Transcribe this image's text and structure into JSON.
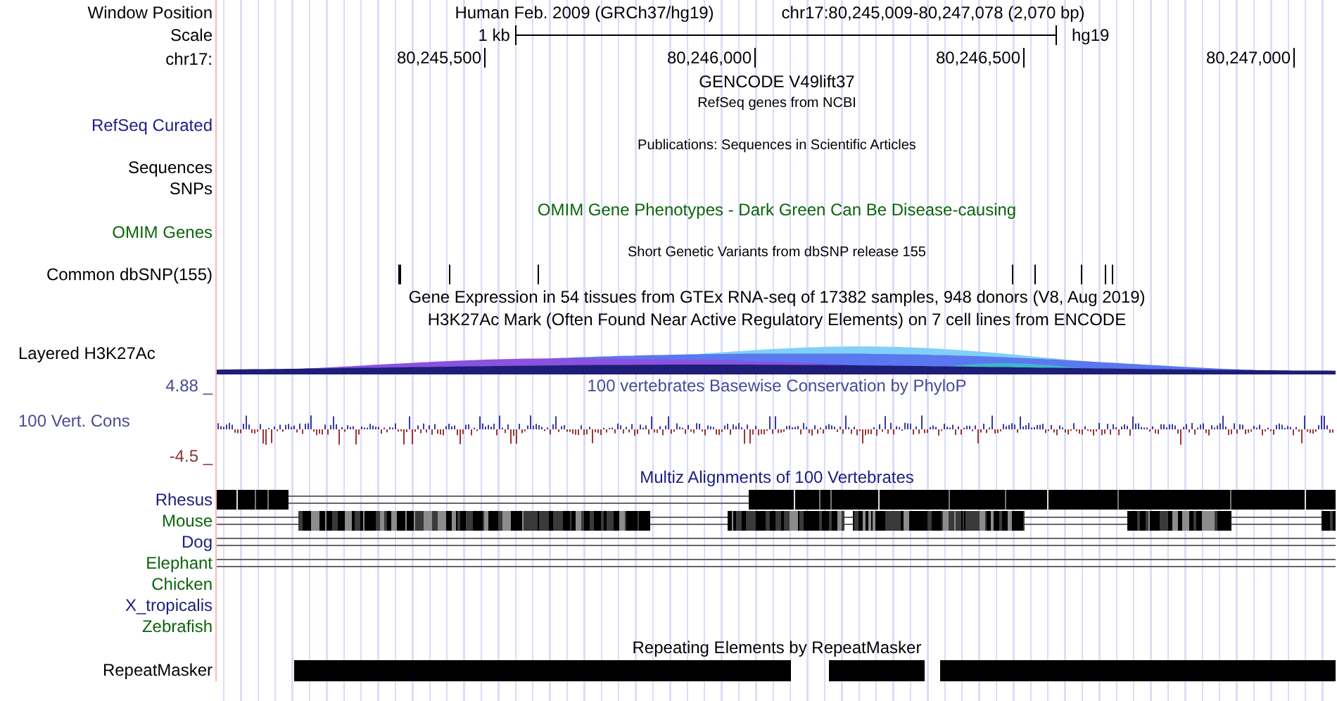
{
  "rows": [
    {
      "kind": "position",
      "label": "Window Position",
      "texts": [
        "Human Feb. 2009 (GRCh37/hg19)",
        "chr17:80,245,009-80,247,078 (2,070 bp)"
      ]
    },
    {
      "kind": "scale",
      "label": "Scale",
      "length": "1 kb",
      "assembly": "hg19"
    },
    {
      "kind": "ruler",
      "label": "chr17:",
      "ticks": [
        "80,245,500",
        "80,246,000",
        "80,246,500",
        "80,247,000"
      ]
    },
    {
      "kind": "title",
      "title": "GENCODE V49lift37"
    },
    {
      "kind": "subtitle",
      "title": "RefSeq genes from NCBI"
    },
    {
      "kind": "blank",
      "label": "RefSeq Curated",
      "color": "#1c1c8c"
    },
    {
      "kind": "subtitle",
      "title": "Publications: Sequences in Scientific Articles"
    },
    {
      "kind": "blank",
      "label": "Sequences"
    },
    {
      "kind": "blank",
      "label": "SNPs"
    },
    {
      "kind": "title",
      "title": "OMIM Gene Phenotypes - Dark Green Can Be Disease-causing",
      "color": "#0c640c"
    },
    {
      "kind": "blank",
      "label": "OMIM Genes",
      "color": "#0c640c"
    },
    {
      "kind": "subtitle",
      "title": "Short Genetic Variants from dbSNP release 155"
    },
    {
      "kind": "snps",
      "label": "Common dbSNP(155)"
    },
    {
      "kind": "title",
      "title": "Gene Expression in 54 tissues from GTEx RNA-seq of 17382 samples, 948 donors (V8, Aug 2019)"
    },
    {
      "kind": "title",
      "title": "H3K27Ac Mark (Often Found Near Active Regulatory Elements) on 7 cell lines from ENCODE"
    },
    {
      "kind": "layered",
      "label": "Layered H3K27Ac"
    },
    {
      "kind": "axis_top",
      "label": "4.88 _",
      "title": "100 vertebrates Basewise Conservation by PhyloP",
      "color": "#4a4a96"
    },
    {
      "kind": "wiggle",
      "label": "100 Vert. Cons",
      "color": "#4a4a96"
    },
    {
      "kind": "axis_bottom",
      "label": "-4.5 _",
      "color": "#8c3434"
    },
    {
      "kind": "title",
      "title": "Multiz Alignments of 100 Vertebrates",
      "color": "#1c1c7c"
    },
    {
      "kind": "align_dense",
      "label": "Rhesus",
      "color": "#1c1c7c"
    },
    {
      "kind": "align_partial",
      "label": "Mouse",
      "color": "#0c640c"
    },
    {
      "kind": "align_chain",
      "label": "Dog",
      "color": "#1c1c7c"
    },
    {
      "kind": "align_chain",
      "label": "Elephant",
      "color": "#0c640c"
    },
    {
      "kind": "align_none",
      "label": "Chicken",
      "color": "#0c640c"
    },
    {
      "kind": "align_none",
      "label": "X_tropicalis",
      "color": "#1c1c7c"
    },
    {
      "kind": "align_none",
      "label": "Zebrafish",
      "color": "#0c640c"
    },
    {
      "kind": "title",
      "title": "Repeating Elements by RepeatMasker"
    },
    {
      "kind": "repeats",
      "label": "RepeatMasker"
    }
  ]
}
